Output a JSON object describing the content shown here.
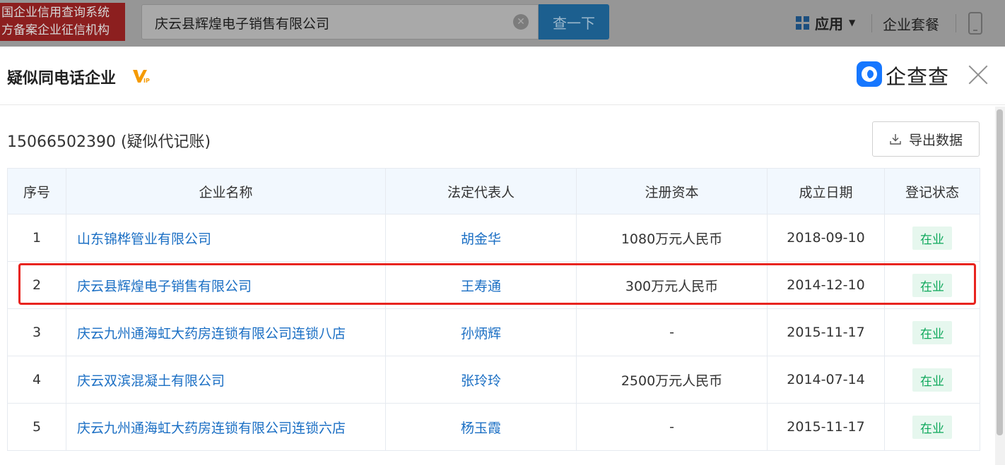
{
  "topbar": {
    "brand_line1": "国企业信用查询系统",
    "brand_line2": "方备案企业征信机构",
    "search_value": "庆云县辉煌电子销售有限公司",
    "search_button": "查一下",
    "apps_label": "应用",
    "package_label": "企业套餐"
  },
  "modal": {
    "title": "疑似同电话企业",
    "logo_text": "企查查",
    "phone_line": "15066502390 (疑似代记账)",
    "export_label": "导出数据"
  },
  "table": {
    "headers": [
      "序号",
      "企业名称",
      "法定代表人",
      "注册资本",
      "成立日期",
      "登记状态"
    ],
    "rows": [
      {
        "index": "1",
        "name": "山东锦桦管业有限公司",
        "rep": "胡金华",
        "capital": "1080万元人民币",
        "date": "2018-09-10",
        "status": "在业"
      },
      {
        "index": "2",
        "name": "庆云县辉煌电子销售有限公司",
        "rep": "王寿通",
        "capital": "300万元人民币",
        "date": "2014-12-10",
        "status": "在业"
      },
      {
        "index": "3",
        "name": "庆云九州通海虹大药房连锁有限公司连锁八店",
        "rep": "孙炳辉",
        "capital": "-",
        "date": "2015-11-17",
        "status": "在业"
      },
      {
        "index": "4",
        "name": "庆云双滨混凝土有限公司",
        "rep": "张玲玲",
        "capital": "2500万元人民币",
        "date": "2014-07-14",
        "status": "在业"
      },
      {
        "index": "5",
        "name": "庆云九州通海虹大药房连锁有限公司连锁六店",
        "rep": "杨玉霞",
        "capital": "-",
        "date": "2015-11-17",
        "status": "在业"
      }
    ]
  },
  "colors": {
    "link": "#1b6fc4",
    "status_text": "#0ea85b",
    "status_bg": "#e6f7ee",
    "highlight": "#e8241f",
    "header_bg": "#f2f8fe"
  }
}
